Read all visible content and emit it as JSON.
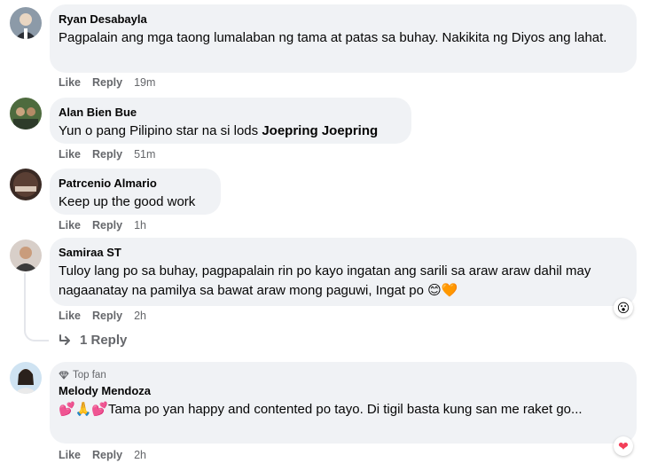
{
  "comments": [
    {
      "author": "Ryan Desabayla",
      "text": "Pagpalain ang mga taong lumalaban ng tama at patas sa buhay. Nakikita ng Diyos ang lahat.",
      "like": "Like",
      "reply": "Reply",
      "time": "19m"
    },
    {
      "author": "Alan Bien Bue",
      "text_prefix": "Yun o pang Pilipino star na si lods ",
      "mention": "Joepring Joepring",
      "like": "Like",
      "reply": "Reply",
      "time": "51m"
    },
    {
      "author": "Patrcenio Almario",
      "text": "Keep up the good work",
      "like": "Like",
      "reply": "Reply",
      "time": "1h"
    },
    {
      "author": "Samiraa ST",
      "text": "Tuloy lang po sa buhay, pagpapalain rin po kayo ingatan ang sarili sa araw araw dahil may nagaanatay na pamilya sa bawat araw mong paguwi, Ingat po 😊🧡",
      "like": "Like",
      "reply": "Reply",
      "time": "2h",
      "reaction": "😮"
    },
    {
      "badge": "Top fan",
      "author": "Melody Mendoza",
      "text": "💕🙏💕Tama po yan happy and contented po tayo. Di tigil basta kung san me raket go...",
      "like": "Like",
      "reply": "Reply",
      "time": "2h",
      "reaction": "❤"
    }
  ],
  "replies_link": "1 Reply",
  "colors": {
    "bubble": "#f0f2f5",
    "meta": "#65676b",
    "love": "#f33e58"
  }
}
